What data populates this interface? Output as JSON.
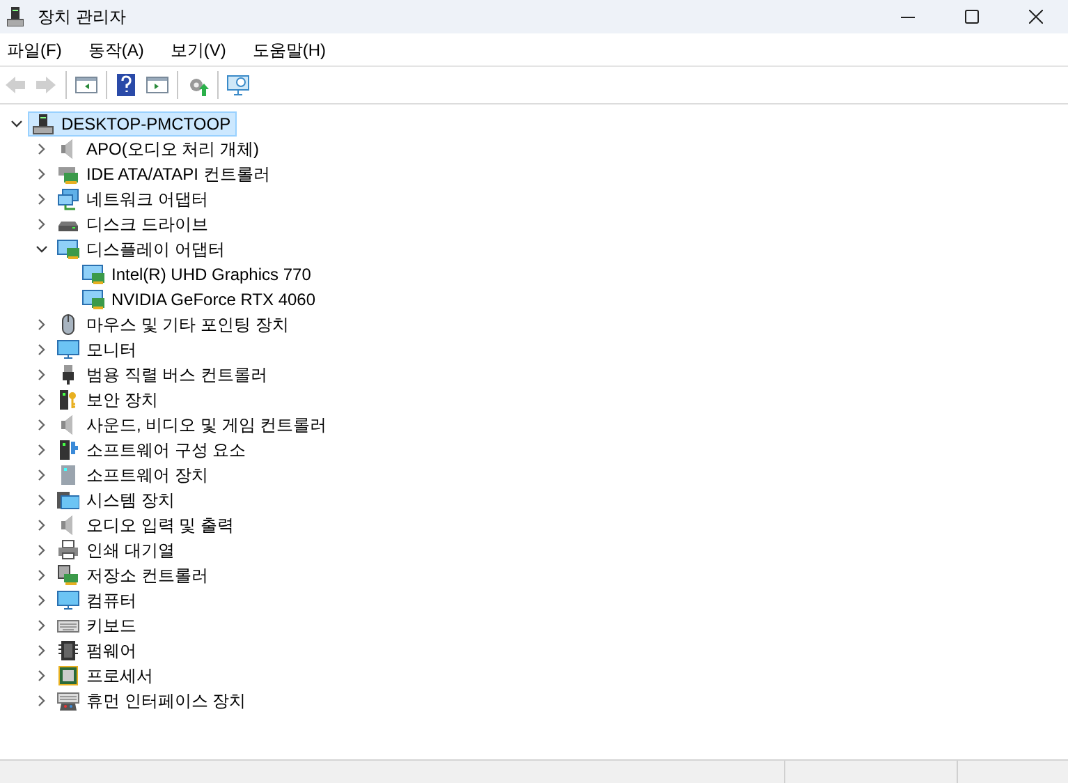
{
  "window": {
    "title": "장치 관리자"
  },
  "menu": [
    "파일(F)",
    "동작(A)",
    "보기(V)",
    "도움말(H)"
  ],
  "toolbar": [
    {
      "kind": "back",
      "disabled": true
    },
    {
      "kind": "forward",
      "disabled": true
    },
    {
      "kind": "sep"
    },
    {
      "kind": "pane"
    },
    {
      "kind": "sep"
    },
    {
      "kind": "help"
    },
    {
      "kind": "pane2"
    },
    {
      "kind": "sep"
    },
    {
      "kind": "update"
    },
    {
      "kind": "sep"
    },
    {
      "kind": "scan"
    }
  ],
  "tree": {
    "label": "DESKTOP-PMCTOOP",
    "kind": "computer-tower",
    "expanded": true,
    "selected": true,
    "children": [
      {
        "label": "APO(오디오 처리 개체)",
        "kind": "speaker",
        "expanded": false
      },
      {
        "label": "IDE ATA/ATAPI 컨트롤러",
        "kind": "card",
        "expanded": false
      },
      {
        "label": "네트워크 어댑터",
        "kind": "network",
        "expanded": false
      },
      {
        "label": "디스크 드라이브",
        "kind": "drive",
        "expanded": false
      },
      {
        "label": "디스플레이 어댑터",
        "kind": "display",
        "expanded": true,
        "children": [
          {
            "label": "Intel(R) UHD Graphics 770",
            "kind": "display"
          },
          {
            "label": "NVIDIA GeForce RTX 4060",
            "kind": "display"
          }
        ]
      },
      {
        "label": "마우스 및 기타 포인팅 장치",
        "kind": "mouse",
        "expanded": false
      },
      {
        "label": "모니터",
        "kind": "monitor",
        "expanded": false
      },
      {
        "label": "범용 직렬 버스 컨트롤러",
        "kind": "usb",
        "expanded": false
      },
      {
        "label": "보안 장치",
        "kind": "security",
        "expanded": false
      },
      {
        "label": "사운드, 비디오 및 게임 컨트롤러",
        "kind": "speaker",
        "expanded": false
      },
      {
        "label": "소프트웨어 구성 요소",
        "kind": "software-component",
        "expanded": false
      },
      {
        "label": "소프트웨어 장치",
        "kind": "software-device",
        "expanded": false
      },
      {
        "label": "시스템 장치",
        "kind": "system",
        "expanded": false
      },
      {
        "label": "오디오 입력 및 출력",
        "kind": "speaker",
        "expanded": false
      },
      {
        "label": "인쇄 대기열",
        "kind": "printer",
        "expanded": false
      },
      {
        "label": "저장소 컨트롤러",
        "kind": "storage",
        "expanded": false
      },
      {
        "label": "컴퓨터",
        "kind": "monitor",
        "expanded": false
      },
      {
        "label": "키보드",
        "kind": "keyboard",
        "expanded": false
      },
      {
        "label": "펌웨어",
        "kind": "chip",
        "expanded": false
      },
      {
        "label": "프로세서",
        "kind": "processor",
        "expanded": false
      },
      {
        "label": "휴먼 인터페이스 장치",
        "kind": "hid",
        "expanded": false
      }
    ]
  }
}
